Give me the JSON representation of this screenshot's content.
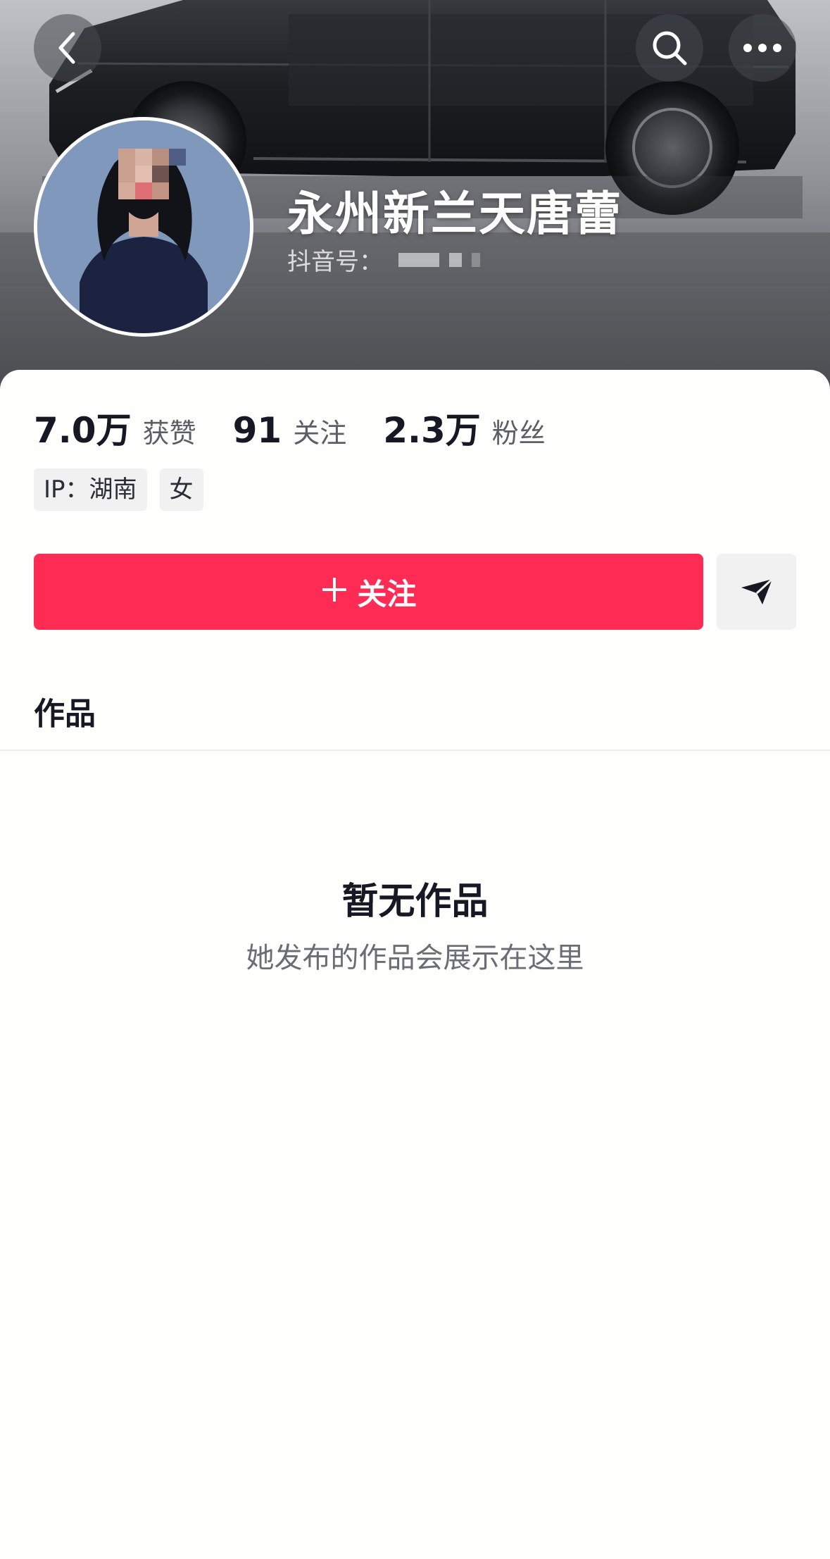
{
  "header": {
    "back_icon": "chevron-left-icon",
    "search_icon": "search-icon",
    "more_icon": "more-horizontal-icon",
    "name": "永州新兰天唐蕾",
    "douyin_id_label": "抖音号："
  },
  "stats": [
    {
      "value": "7.0万",
      "label": "获赞"
    },
    {
      "value": "91",
      "label": "关注"
    },
    {
      "value": "2.3万",
      "label": "粉丝"
    }
  ],
  "tags": [
    "IP：湖南",
    "女"
  ],
  "actions": {
    "follow_label": "关注",
    "follow_color": "#fe2c55",
    "message_icon": "send-icon"
  },
  "tabs": {
    "works_label": "作品"
  },
  "empty_state": {
    "title": "暂无作品",
    "subtitle": "她发布的作品会展示在这里"
  }
}
